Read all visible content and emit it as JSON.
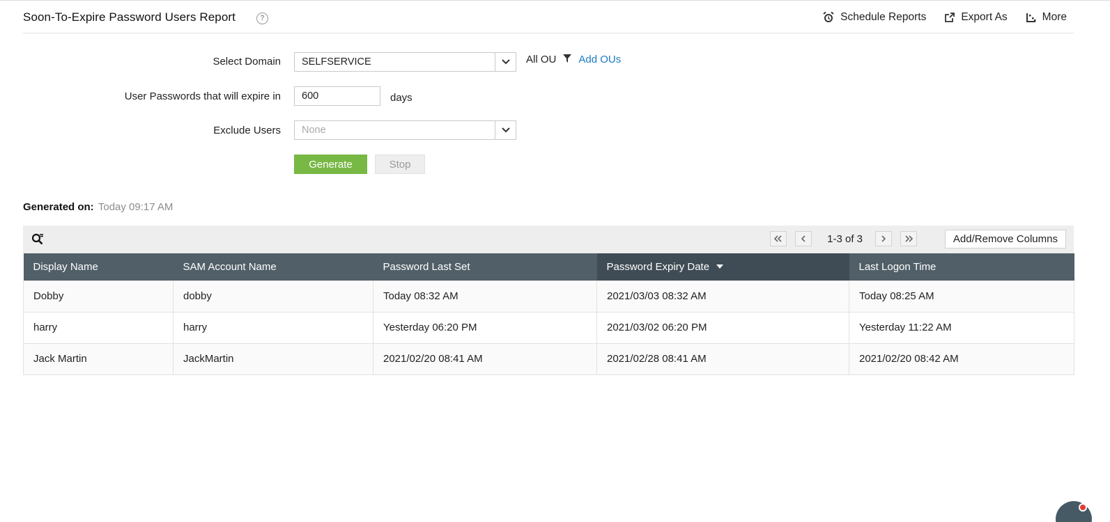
{
  "header": {
    "title": "Soon-To-Expire Password Users Report",
    "help_icon": "question-circle-icon",
    "actions": [
      {
        "label": "Schedule Reports",
        "icon": "alarm-clock-icon"
      },
      {
        "label": "Export As",
        "icon": "export-icon"
      },
      {
        "label": "More",
        "icon": "more-icon"
      }
    ]
  },
  "form": {
    "domain_label": "Select Domain",
    "domain_value": "SELFSERVICE",
    "ou_label": "All OU",
    "add_ous": "Add OUs",
    "expire_label": "User Passwords that will expire in",
    "expire_value": "600",
    "days_label": "days",
    "exclude_label": "Exclude Users",
    "exclude_placeholder": "None",
    "generate": "Generate",
    "stop": "Stop"
  },
  "generated": {
    "label": "Generated on:",
    "time": "Today 09:17 AM"
  },
  "toolbar": {
    "page_info": "1-3 of 3",
    "add_remove_columns": "Add/Remove Columns"
  },
  "table": {
    "columns": [
      "Display Name",
      "SAM Account Name",
      "Password Last Set",
      "Password Expiry Date",
      "Last Logon Time"
    ],
    "sorted_column": "Password Expiry Date",
    "rows": [
      [
        "Dobby",
        "dobby",
        "Today 08:32 AM",
        "2021/03/03 08:32 AM",
        "Today 08:25 AM"
      ],
      [
        "harry",
        "harry",
        "Yesterday 06:20 PM",
        "2021/03/02 06:20 PM",
        "Yesterday 11:22 AM"
      ],
      [
        "Jack Martin",
        "JackMartin",
        "2021/02/20 08:41 AM",
        "2021/02/28 08:41 AM",
        "2021/02/20 08:42 AM"
      ]
    ]
  },
  "colors": {
    "accent_green": "#78b845",
    "link_blue": "#1a7bc0",
    "header_bg": "#515f68",
    "sorted_header_bg": "#404c55"
  }
}
